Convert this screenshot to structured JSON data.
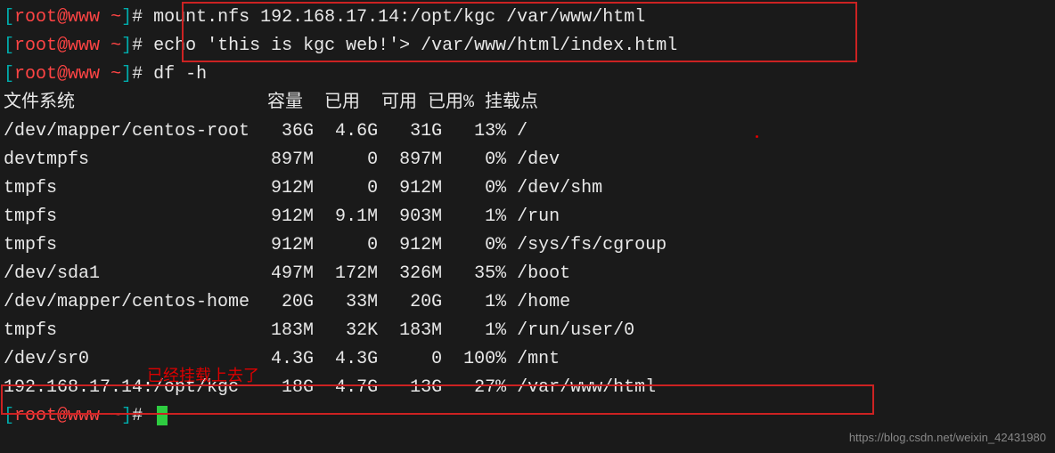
{
  "prompt": {
    "open": "[",
    "user": "root",
    "at": "@",
    "host": "www",
    "tilde": " ~",
    "close": "]",
    "hash": "# "
  },
  "commands": {
    "cmd1": "mount.nfs 192.168.17.14:/opt/kgc /var/www/html",
    "cmd2": "echo 'this is kgc web!'> /var/www/html/index.html",
    "cmd3": "df -h"
  },
  "df": {
    "header": "文件系统                  容量  已用  可用 已用% 挂载点",
    "rows": [
      "/dev/mapper/centos-root   36G  4.6G   31G   13% /",
      "devtmpfs                 897M     0  897M    0% /dev",
      "tmpfs                    912M     0  912M    0% /dev/shm",
      "tmpfs                    912M  9.1M  903M    1% /run",
      "tmpfs                    912M     0  912M    0% /sys/fs/cgroup",
      "/dev/sda1                497M  172M  326M   35% /boot",
      "/dev/mapper/centos-home   20G   33M   20G    1% /home",
      "tmpfs                    183M   32K  183M    1% /run/user/0",
      "/dev/sr0                 4.3G  4.3G     0  100% /mnt",
      "192.168.17.14:/opt/kgc    18G  4.7G   13G   27% /var/www/html"
    ]
  },
  "annotation": "已经挂载上去了",
  "watermark": "https://blog.csdn.net/weixin_42431980"
}
